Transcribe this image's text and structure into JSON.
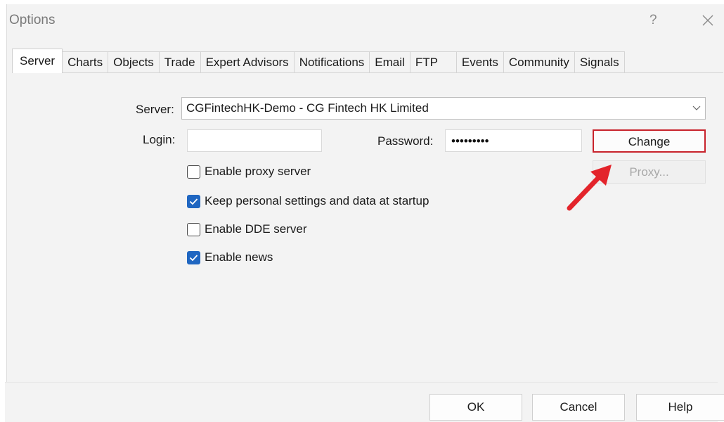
{
  "window": {
    "title": "Options",
    "help_glyph": "?"
  },
  "tabs": [
    {
      "label": "Server",
      "active": true
    },
    {
      "label": "Charts"
    },
    {
      "label": "Objects"
    },
    {
      "label": "Trade"
    },
    {
      "label": "Expert Advisors"
    },
    {
      "label": "Notifications"
    },
    {
      "label": "Email"
    },
    {
      "label": "FTP"
    },
    {
      "label": "Events"
    },
    {
      "label": "Community"
    },
    {
      "label": "Signals"
    }
  ],
  "server": {
    "label": "Server:",
    "value": "CGFintechHK-Demo - CG Fintech HK Limited"
  },
  "login": {
    "label": "Login:",
    "value": ""
  },
  "password": {
    "label": "Password:",
    "value": "•••••••••"
  },
  "buttons": {
    "change": "Change",
    "proxy": "Proxy..."
  },
  "checkboxes": [
    {
      "label": "Enable proxy server",
      "checked": false
    },
    {
      "label": "Keep personal settings and data at startup",
      "checked": true
    },
    {
      "label": "Enable DDE server",
      "checked": false
    },
    {
      "label": "Enable news",
      "checked": true
    }
  ],
  "footer": {
    "ok": "OK",
    "cancel": "Cancel",
    "help": "Help"
  },
  "colors": {
    "highlight": "#c8232c",
    "arrow": "#e3242b",
    "checkbox_checked": "#1f66c1"
  },
  "icons": {
    "close": "close-icon",
    "dropdown": "chevron-down-icon",
    "check": "check-icon",
    "annotation": "arrow-annotation"
  }
}
